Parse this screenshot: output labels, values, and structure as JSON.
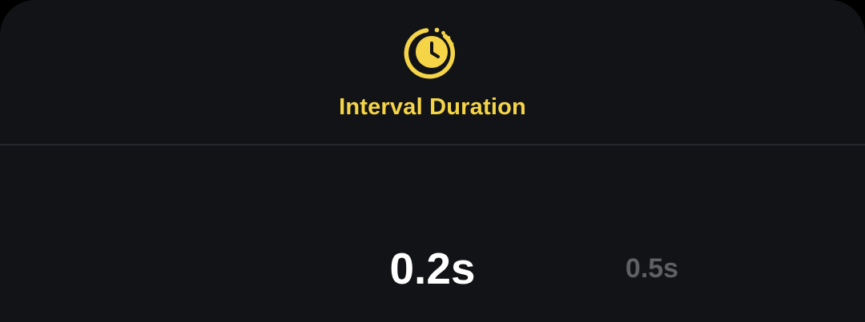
{
  "header": {
    "icon": "timer-clock-icon",
    "title": "Interval Duration"
  },
  "picker": {
    "options": [
      {
        "label": "0.2s",
        "selected": true
      },
      {
        "label": "0.5s",
        "selected": false
      }
    ]
  },
  "colors": {
    "accent": "#F5D547",
    "background": "#121317",
    "divider": "#26272c",
    "selected_text": "#ffffff",
    "unselected_text": "#5f6064"
  }
}
